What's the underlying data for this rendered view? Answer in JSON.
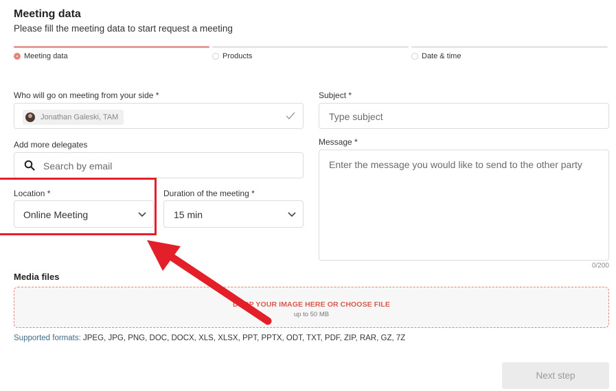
{
  "header": {
    "title": "Meeting data",
    "subtitle": "Please fill the meeting data to start request a meeting"
  },
  "steps": [
    {
      "label": "Meeting data",
      "active": true
    },
    {
      "label": "Products",
      "active": false
    },
    {
      "label": "Date & time",
      "active": false
    }
  ],
  "form": {
    "who_label": "Who will go on meeting from your side *",
    "who_value": "Jonathan Galeski, TAM",
    "delegates_label": "Add more delegates",
    "delegates_placeholder": "Search by email",
    "location_label": "Location *",
    "location_value": "Online Meeting",
    "duration_label": "Duration of the meeting *",
    "duration_value": "15 min",
    "subject_label": "Subject *",
    "subject_placeholder": "Type subject",
    "message_label": "Message *",
    "message_placeholder": "Enter the message you would like to send to the other party",
    "message_counter": "0/200"
  },
  "media": {
    "label": "Media files",
    "drop_text": "DROP YOUR IMAGE HERE OR CHOOSE FILE",
    "drop_limit": "up to 50 MB",
    "formats_label": "Supported formats:",
    "formats_list": "JPEG, JPG, PNG, DOC, DOCX, XLS, XLSX, PPT, PPTX, ODT, TXT, PDF, ZIP, RAR, GZ, 7Z"
  },
  "actions": {
    "next_label": "Next step"
  },
  "colors": {
    "accent": "#e8837a",
    "annotation": "#e3202a"
  }
}
